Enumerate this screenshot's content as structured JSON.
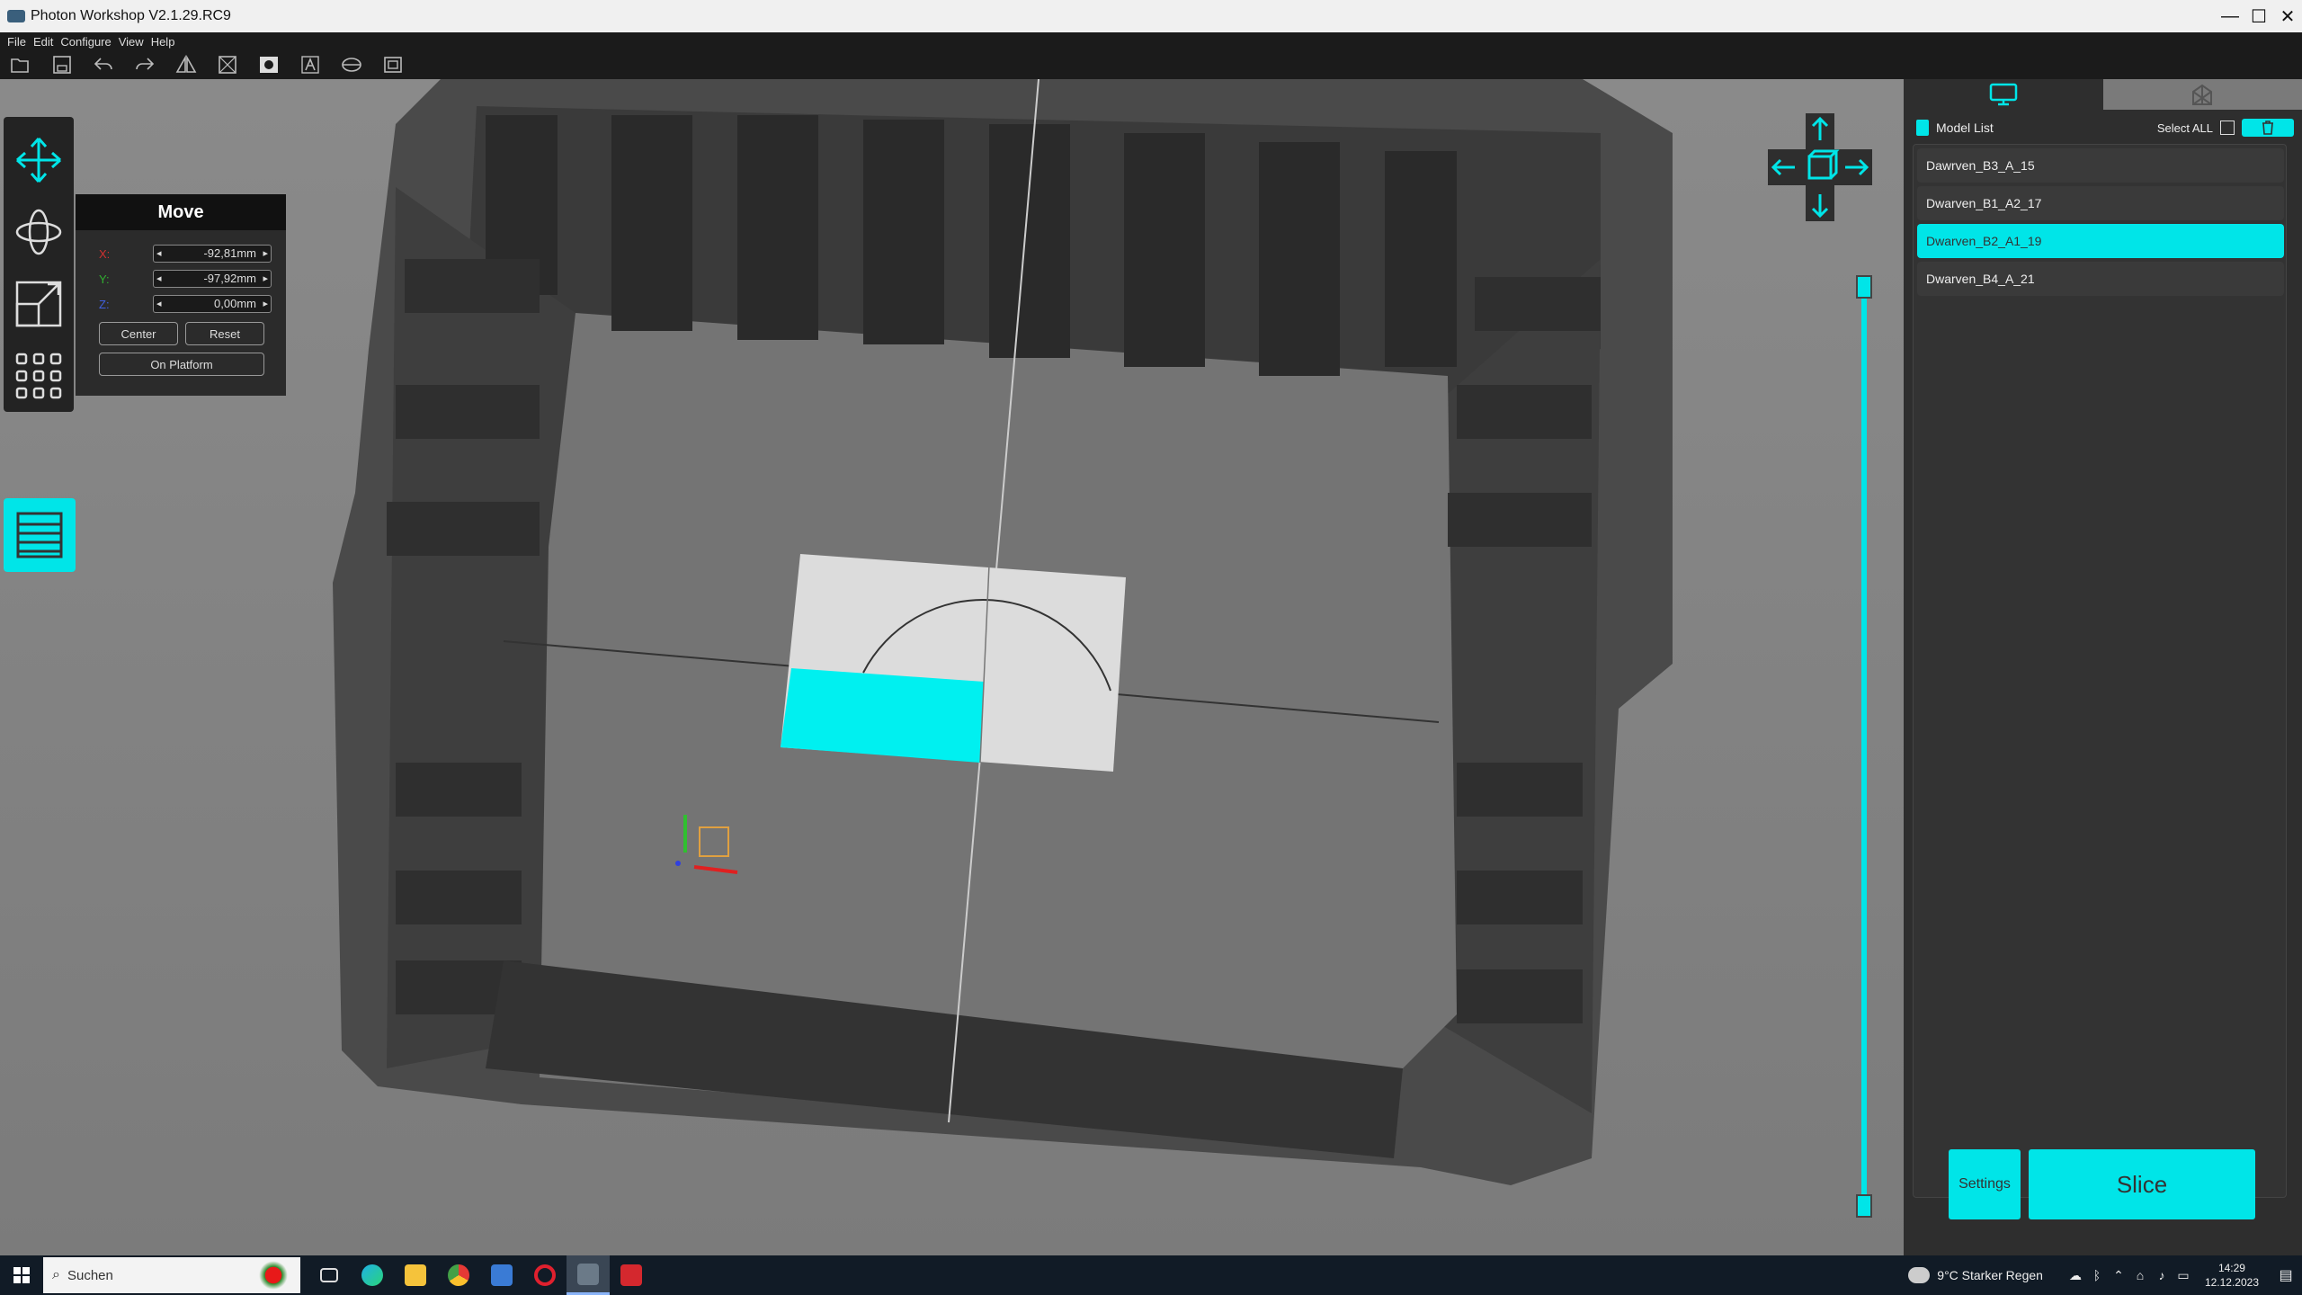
{
  "window": {
    "title": "Photon Workshop V2.1.29.RC9",
    "minimize": "—",
    "maximize": "☐",
    "close": "✕"
  },
  "menu": [
    "File",
    "Edit",
    "Configure",
    "View",
    "Help"
  ],
  "toolbar_icons": [
    "open-icon",
    "save-icon",
    "undo-icon",
    "redo-icon",
    "mirror-icon",
    "hollow-icon",
    "punch-icon",
    "text-icon",
    "repair-icon",
    "layout-icon"
  ],
  "move_panel": {
    "title": "Move",
    "x_label": "X:",
    "x_value": "-92,81mm",
    "y_label": "Y:",
    "y_value": "-97,92mm",
    "z_label": "Z:",
    "z_value": "0,00mm",
    "center_label": "Center",
    "reset_label": "Reset",
    "on_platform_label": "On Platform"
  },
  "model_list": {
    "title": "Model List",
    "select_all": "Select ALL",
    "items": [
      {
        "label": "Dawrven_B3_A_15",
        "selected": false
      },
      {
        "label": "Dwarven_B1_A2_17",
        "selected": false
      },
      {
        "label": "Dwarven_B2_A1_19",
        "selected": true
      },
      {
        "label": "Dwarven_B4_A_21",
        "selected": false
      }
    ]
  },
  "buttons": {
    "settings": "Settings",
    "slice": "Slice"
  },
  "layer_slider": {
    "lower": 0.0,
    "upper": 1.0
  },
  "taskbar": {
    "search_placeholder": "Suchen",
    "weather": "9°C  Starker Regen",
    "time": "14:29",
    "date": "12.12.2023"
  },
  "colors": {
    "accent": "#00e5e8",
    "panel_bg": "#2e2e2e",
    "viewport_bg": "#808080"
  }
}
